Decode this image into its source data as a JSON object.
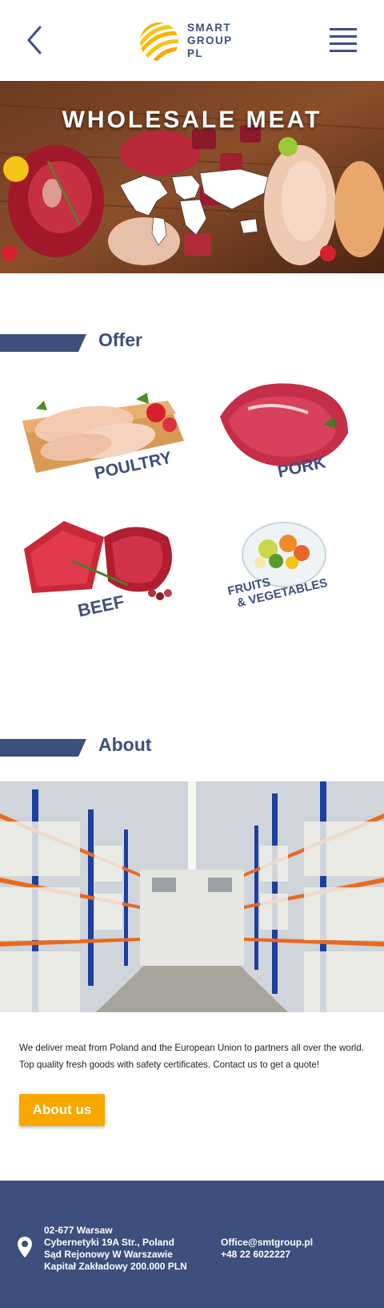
{
  "header": {
    "logo_line1": "SMART",
    "logo_line2": "GROUP",
    "logo_line3": "PL"
  },
  "hero": {
    "title": "WHOLESALE MEAT"
  },
  "offer": {
    "title": "Offer",
    "items": [
      {
        "label": "POULTRY"
      },
      {
        "label": "PORK"
      },
      {
        "label": "BEEF"
      },
      {
        "label_line1": "FRUITS",
        "label_line2": "& VEGETABLES"
      }
    ]
  },
  "about": {
    "title": "About",
    "text": "We deliver meat from Poland and the European Union to partners all over the world. Top quality fresh goods with safety certificates. Contact us to get a quote!",
    "button_label": "About us"
  },
  "footer": {
    "address": [
      "02-677 Warsaw",
      "Cybernetyki 19A Str., Poland",
      "Sąd Rejonowy W Warszawie",
      "Kapitał Zakładowy 200.000 PLN"
    ],
    "email": "Office@smtgroup.pl",
    "phone": "+48 22 6022227"
  },
  "colors": {
    "brand_navy": "#3d4f7c",
    "accent_orange": "#f8a800",
    "logo_yellow": "#f5c518"
  }
}
